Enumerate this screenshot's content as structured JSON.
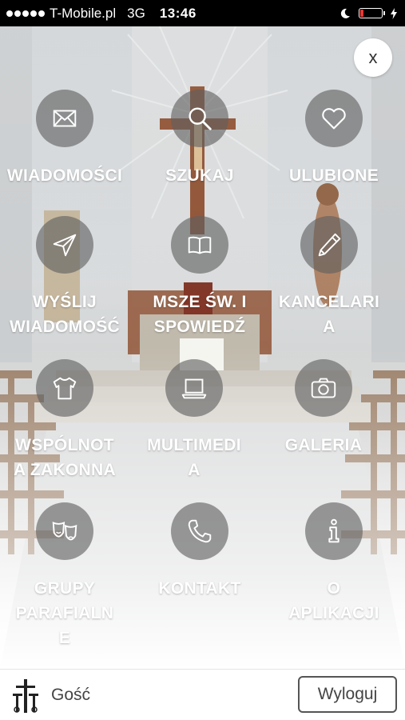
{
  "status_bar": {
    "carrier": "T-Mobile.pl",
    "network": "3G",
    "time": "13:46",
    "battery_level": 0.15,
    "battery_color": "#e53935"
  },
  "close_label": "x",
  "menu": [
    {
      "label": "WIADOMOŚCI",
      "icon": "envelope-icon"
    },
    {
      "label": "SZUKAJ",
      "icon": "search-icon"
    },
    {
      "label": "ULUBIONE",
      "icon": "heart-icon"
    },
    {
      "label": "WYŚLIJ\nWIADOMOŚĆ",
      "icon": "paper-plane-icon"
    },
    {
      "label": "MSZE ŚW. I\nSPOWIEDŹ",
      "icon": "book-icon"
    },
    {
      "label": "KANCELARI\nA",
      "icon": "pencil-icon"
    },
    {
      "label": "WSPÓLNOT\nA ZAKONNA",
      "icon": "tshirt-icon"
    },
    {
      "label": "MULTIMEDI\nA",
      "icon": "laptop-icon"
    },
    {
      "label": "GALERIA",
      "icon": "camera-icon"
    },
    {
      "label": "GRUPY\nPARAFIALN\nE",
      "icon": "theater-masks-icon"
    },
    {
      "label": "KONTAKT",
      "icon": "phone-icon"
    },
    {
      "label": "O\nAPLIKACJI",
      "icon": "info-icon"
    }
  ],
  "footer": {
    "user_name": "Gość",
    "logout_label": "Wyloguj"
  }
}
